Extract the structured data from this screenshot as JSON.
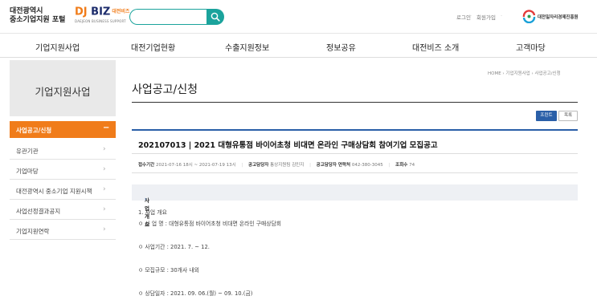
{
  "header": {
    "portal_line1": "대전광역시",
    "portal_line2": "중소기업지원 포털",
    "djbiz_dj": "DJ",
    "djbiz_biz": "BIZ",
    "djbiz_kr": "대전비즈",
    "djbiz_sub": "DAEJEON BUSINESS SUPPORT",
    "search_placeholder": "",
    "login": "로그인",
    "join": "회원가입",
    "separator": "·",
    "center_name": "대전일자리경제진흥원"
  },
  "gnb": [
    "기업지원사업",
    "대전기업현황",
    "수출지원정보",
    "정보공유",
    "대전비즈 소개",
    "고객마당"
  ],
  "sidebar": {
    "title": "기업지원사업",
    "active": "사업공고/신청",
    "active_icon": "−",
    "items": [
      {
        "label": "유관기관",
        "chev": "›"
      },
      {
        "label": "기업마당",
        "chev": "›"
      },
      {
        "label": "대전광역시 중소기업 지원시책",
        "chev": "›"
      },
      {
        "label": "사업선정결과공지",
        "chev": "›"
      },
      {
        "label": "기업지원연락",
        "chev": "›"
      }
    ]
  },
  "content": {
    "breadcrumb": "HOME  ›  기업지원사업  ›  사업공고/신청",
    "page_title": "사업공고/신청",
    "print_btn": "프린트",
    "list_btn": "목록",
    "post_title": "202107013 | 2021 대형유통점 바이어초청 비대면 온라인 구매상담회 참여기업 모집공고",
    "meta": {
      "period_label": "접수기간",
      "period": "2021-07-16 18시 ~ 2021-07-19 13시",
      "manager_label": "공고담당자",
      "manager": "통상지원팀 김민지",
      "phone_label": "공고담당자 연락처",
      "phone": "042-380-3045",
      "views_label": "조회수",
      "views": "74",
      "separator": "|"
    },
    "section_arrow": "›",
    "section_title": "사업개요",
    "body": [
      "1. 사업 개요",
      "ㅇ 사 업 명 : 대형유통점 바이어초청 비대면 온라인 구매상담회",
      "ㅇ 사업기간 : 2021. 7. ~ 12.",
      "ㅇ 모집규모 : 30개사 내외",
      "ㅇ 상담일자 : 2021. 09. 06.(월) ~ 09. 10.(금)"
    ]
  }
}
